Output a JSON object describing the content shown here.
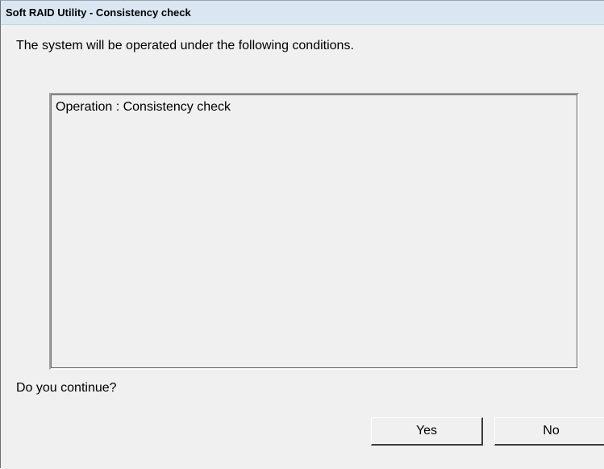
{
  "window": {
    "title": "Soft RAID Utility - Consistency check"
  },
  "dialog": {
    "intro": "The system will be operated under the following conditions.",
    "conditions": [
      "Operation : Consistency check"
    ],
    "question": "Do you continue?"
  },
  "buttons": {
    "yes_label": "Yes",
    "no_label": "No"
  }
}
